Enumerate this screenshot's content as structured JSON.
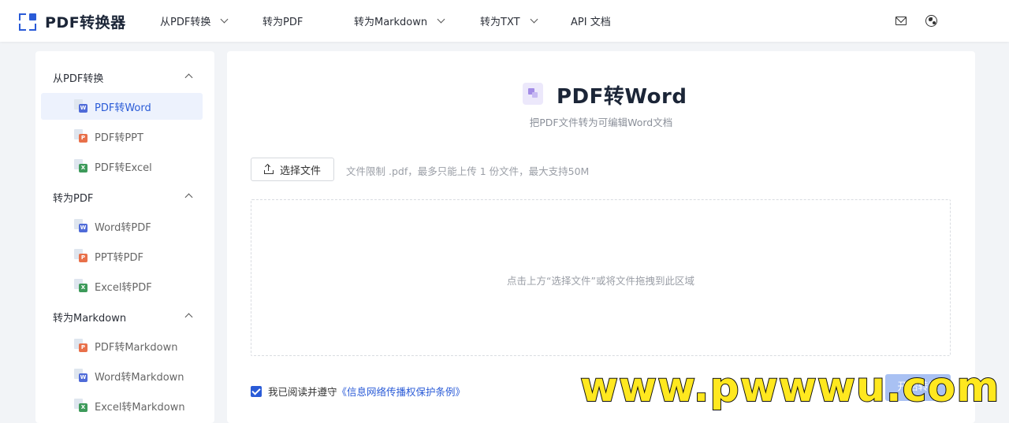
{
  "header": {
    "brand": "PDF转换器",
    "nav": [
      {
        "label": "从PDF转换",
        "dropdown": true
      },
      {
        "label": "转为PDF",
        "dropdown": false
      },
      {
        "label": "转为Markdown",
        "dropdown": true
      },
      {
        "label": "转为TXT",
        "dropdown": true
      },
      {
        "label": "API 文档",
        "dropdown": false
      }
    ],
    "icons": [
      "mail-icon",
      "globe-icon"
    ]
  },
  "sidebar": {
    "groups": [
      {
        "label": "从PDF转换",
        "items": [
          {
            "label": "PDF转Word",
            "badge": "W",
            "color": "#4f6bd8",
            "active": true
          },
          {
            "label": "PDF转PPT",
            "badge": "P",
            "color": "#e8704a",
            "active": false
          },
          {
            "label": "PDF转Excel",
            "badge": "X",
            "color": "#3d9a5a",
            "active": false
          }
        ]
      },
      {
        "label": "转为PDF",
        "items": [
          {
            "label": "Word转PDF",
            "badge": "W",
            "color": "#4f6bd8",
            "active": false
          },
          {
            "label": "PPT转PDF",
            "badge": "P",
            "color": "#e8704a",
            "active": false
          },
          {
            "label": "Excel转PDF",
            "badge": "X",
            "color": "#3d9a5a",
            "active": false
          }
        ]
      },
      {
        "label": "转为Markdown",
        "items": [
          {
            "label": "PDF转Markdown",
            "badge": "P",
            "color": "#e8704a",
            "active": false
          },
          {
            "label": "Word转Markdown",
            "badge": "W",
            "color": "#4f6bd8",
            "active": false
          },
          {
            "label": "Excel转Markdown",
            "badge": "X",
            "color": "#3d9a5a",
            "active": false
          }
        ]
      }
    ]
  },
  "main": {
    "title": "PDF转Word",
    "subtitle": "把PDF文件转为可编辑Word文档",
    "choose_button": "选择文件",
    "limit_text": "文件限制 .pdf，最多只能上传 1 份文件，最大支持50M",
    "drop_hint": "点击上方“选择文件”或将文件拖拽到此区域",
    "agree_prefix": "我已阅读并遵守",
    "agree_link": "《信息网络传播权保护条例》",
    "agree_checked": true,
    "start_button": "开始转换"
  },
  "watermark": "www.pwwwu.com",
  "colors": {
    "accent": "#2a5bd7",
    "active_bg": "#edf2fd",
    "watermark": "#ffe81f"
  }
}
